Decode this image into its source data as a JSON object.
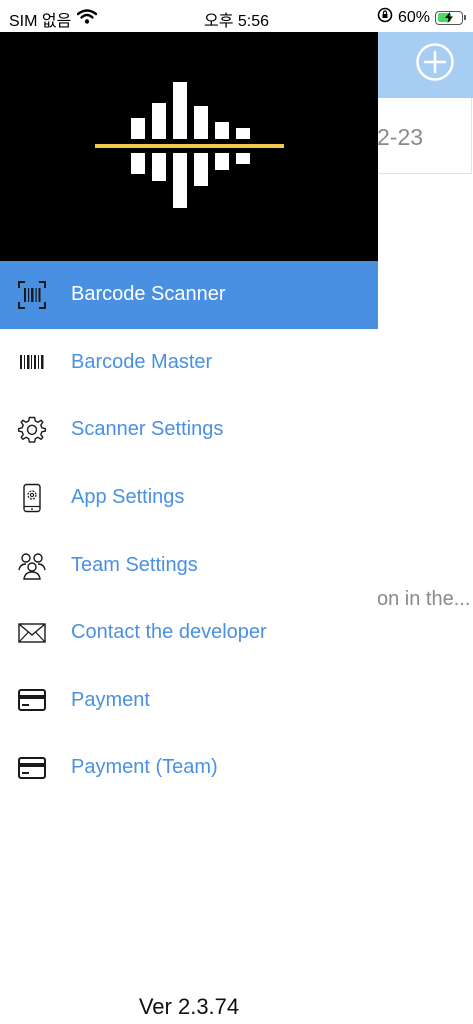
{
  "status_bar": {
    "carrier": "SIM 없음",
    "time": "오후 5:56",
    "battery_percent": "60%",
    "battery_level": 0.6
  },
  "background": {
    "date_partial": "2-23",
    "hint_partial": "on in the..."
  },
  "drawer": {
    "menu": [
      {
        "label": "Barcode Scanner",
        "icon": "barcode-scan-icon",
        "active": true
      },
      {
        "label": "Barcode Master",
        "icon": "barcode-icon",
        "active": false
      },
      {
        "label": "Scanner Settings",
        "icon": "gear-icon",
        "active": false
      },
      {
        "label": "App Settings",
        "icon": "phone-settings-icon",
        "active": false
      },
      {
        "label": "Team Settings",
        "icon": "team-icon",
        "active": false
      },
      {
        "label": "Contact the developer",
        "icon": "envelope-icon",
        "active": false
      },
      {
        "label": "Payment",
        "icon": "credit-card-icon",
        "active": false
      },
      {
        "label": "Payment (Team)",
        "icon": "credit-card-icon",
        "active": false
      }
    ],
    "version": "Ver 2.3.74"
  },
  "colors": {
    "accent": "#4a90e2",
    "header_bg": "#a8cdf2",
    "banner_bg": "#000000",
    "logo_bars": "#ffffff",
    "logo_line": "#f2c94c"
  }
}
